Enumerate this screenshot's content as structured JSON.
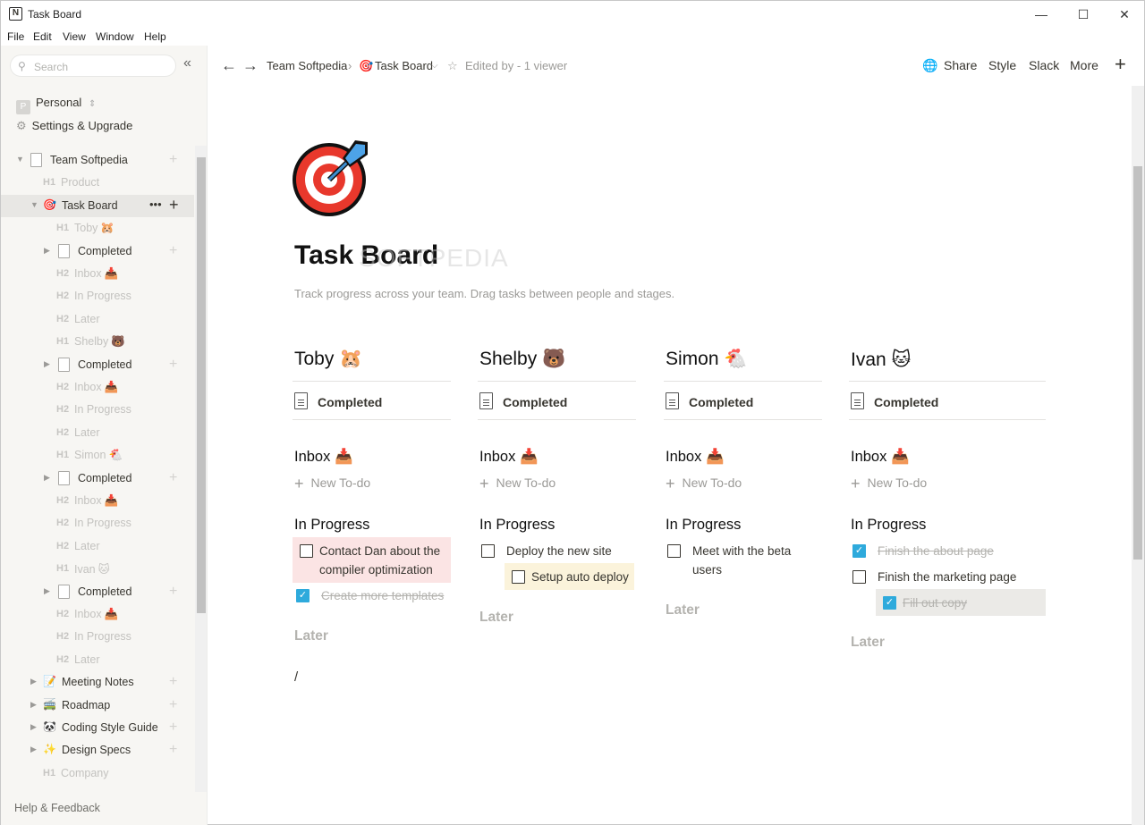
{
  "window": {
    "title": "Task Board",
    "min": "—",
    "max": "☐",
    "close": "✕"
  },
  "menu": [
    "File",
    "Edit",
    "View",
    "Window",
    "Help"
  ],
  "sidebar": {
    "search_placeholder": "Search",
    "workspace": {
      "badge": "P",
      "name": "Personal"
    },
    "settings": "Settings & Upgrade",
    "tree": [
      {
        "label": "Team Softpedia",
        "kind": "page",
        "level": 0,
        "arrow": "▼"
      },
      {
        "label": "Product",
        "kind": "H1",
        "level": 1
      },
      {
        "label": "Task Board",
        "kind": "emoji",
        "icon": "🎯",
        "level": 1,
        "arrow": "▼",
        "selected": true
      },
      {
        "label": "Toby",
        "kind": "H1",
        "level": 2,
        "emoji": "🐹"
      },
      {
        "label": "Completed",
        "kind": "page",
        "level": 2,
        "arrow": "▶"
      },
      {
        "label": "Inbox",
        "kind": "H2",
        "level": 2,
        "emoji": "📥"
      },
      {
        "label": "In Progress",
        "kind": "H2",
        "level": 2
      },
      {
        "label": "Later",
        "kind": "H2",
        "level": 2
      },
      {
        "label": "Shelby",
        "kind": "H1",
        "level": 2,
        "emoji": "🐻"
      },
      {
        "label": "Completed",
        "kind": "page",
        "level": 2,
        "arrow": "▶"
      },
      {
        "label": "Inbox",
        "kind": "H2",
        "level": 2,
        "emoji": "📥"
      },
      {
        "label": "In Progress",
        "kind": "H2",
        "level": 2
      },
      {
        "label": "Later",
        "kind": "H2",
        "level": 2
      },
      {
        "label": "Simon",
        "kind": "H1",
        "level": 2,
        "emoji": "🐔"
      },
      {
        "label": "Completed",
        "kind": "page",
        "level": 2,
        "arrow": "▶"
      },
      {
        "label": "Inbox",
        "kind": "H2",
        "level": 2,
        "emoji": "📥"
      },
      {
        "label": "In Progress",
        "kind": "H2",
        "level": 2
      },
      {
        "label": "Later",
        "kind": "H2",
        "level": 2
      },
      {
        "label": "Ivan",
        "kind": "H1",
        "level": 2,
        "emoji": "🐱"
      },
      {
        "label": "Completed",
        "kind": "page",
        "level": 2,
        "arrow": "▶"
      },
      {
        "label": "Inbox",
        "kind": "H2",
        "level": 2,
        "emoji": "📥"
      },
      {
        "label": "In Progress",
        "kind": "H2",
        "level": 2
      },
      {
        "label": "Later",
        "kind": "H2",
        "level": 2
      },
      {
        "label": "Meeting Notes",
        "kind": "emoji",
        "icon": "📝",
        "level": 1,
        "arrow": "▶"
      },
      {
        "label": "Roadmap",
        "kind": "emoji",
        "icon": "🚎",
        "level": 1,
        "arrow": "▶"
      },
      {
        "label": "Coding Style Guide",
        "kind": "emoji",
        "icon": "🐼",
        "level": 1,
        "arrow": "▶"
      },
      {
        "label": "Design Specs",
        "kind": "emoji",
        "icon": "✨",
        "level": 1,
        "arrow": "▶"
      },
      {
        "label": "Company",
        "kind": "H1",
        "level": 1
      }
    ],
    "help": "Help & Feedback"
  },
  "topbar": {
    "crumb_workspace": "Team Softpedia",
    "crumb_sep": "›",
    "crumb_page": "Task Board",
    "edited": "Edited by  - 1 viewer",
    "share": "Share",
    "style": "Style",
    "slack": "Slack",
    "more": "More"
  },
  "page": {
    "title": "Task Board",
    "watermark": "SOFTPEDIA",
    "description": "Track progress across your team.  Drag tasks between people and stages.",
    "slash": "/",
    "columns": [
      {
        "name": "Toby",
        "emoji": "🐹",
        "completed": "Completed",
        "inbox": "Inbox",
        "new_todo": "New To-do",
        "in_progress": "In Progress",
        "later": "Later",
        "todos": [
          {
            "text": "Contact Dan about the compiler optimization",
            "done": false,
            "highlight": "#fbe4e4"
          },
          {
            "text": "Create more templates",
            "done": true
          }
        ]
      },
      {
        "name": "Shelby",
        "emoji": "🐻",
        "completed": "Completed",
        "inbox": "Inbox",
        "new_todo": "New To-do",
        "in_progress": "In Progress",
        "later": "Later",
        "todos": [
          {
            "text": "Deploy the new site",
            "done": false
          },
          {
            "text": "Setup auto deploy",
            "done": false,
            "highlight": "#fbf3db",
            "indent": true
          }
        ]
      },
      {
        "name": "Simon",
        "emoji": "🐔",
        "completed": "Completed",
        "inbox": "Inbox",
        "new_todo": "New To-do",
        "in_progress": "In Progress",
        "later": "Later",
        "todos": [
          {
            "text": "Meet with the beta users",
            "done": false
          }
        ]
      },
      {
        "name": "Ivan",
        "emoji": "🐱",
        "completed": "Completed",
        "inbox": "Inbox",
        "new_todo": "New To-do",
        "in_progress": "In Progress",
        "later": "Later",
        "todos": [
          {
            "text": "Finish the about page",
            "done": true
          },
          {
            "text": "Finish the marketing page",
            "done": false
          },
          {
            "text": "Fill out copy",
            "done": true,
            "highlight": "#ebeae7",
            "indent": true
          }
        ]
      }
    ]
  }
}
